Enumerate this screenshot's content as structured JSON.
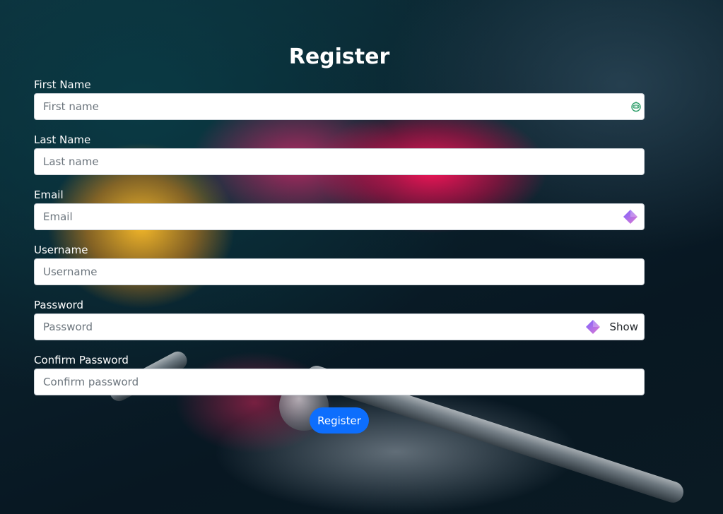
{
  "form": {
    "title": "Register",
    "fields": [
      {
        "label": "First Name",
        "placeholder": "First name",
        "value": ""
      },
      {
        "label": "Last Name",
        "placeholder": "Last name",
        "value": ""
      },
      {
        "label": "Email",
        "placeholder": "Email",
        "value": ""
      },
      {
        "label": "Username",
        "placeholder": "Username",
        "value": ""
      },
      {
        "label": "Password",
        "placeholder": "Password",
        "value": "",
        "toggle_label": "Show"
      },
      {
        "label": "Confirm Password",
        "placeholder": "Confirm password",
        "value": ""
      }
    ],
    "submit_label": "Register"
  },
  "icons": {
    "autofill_bot": "robot-face-icon",
    "password_manager": "diamond-gem-icon"
  },
  "colors": {
    "primary_button": "#0d6efd",
    "title_text": "#ffffff",
    "gem_gradient_start": "#7b61ff",
    "gem_gradient_end": "#e07bd0",
    "bot_icon": "#2e9e6a"
  }
}
